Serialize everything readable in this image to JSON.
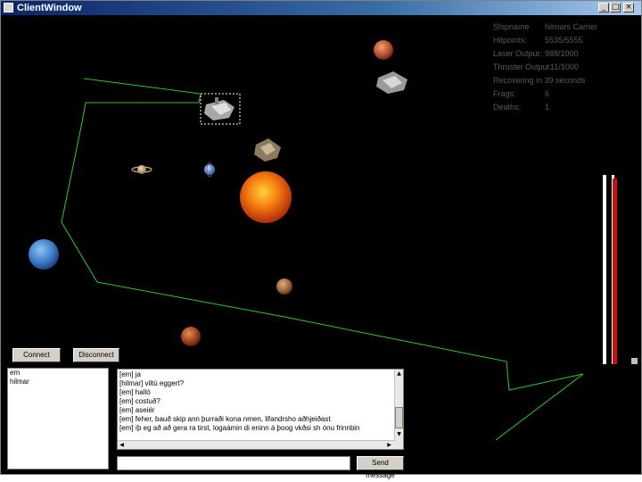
{
  "window": {
    "title": "ClientWindow",
    "minimize": "_",
    "maximize": "□",
    "close": "×"
  },
  "stats": [
    {
      "label": "Shipname",
      "value": "hilmars Carrier"
    },
    {
      "label": "Hitpoints:",
      "value": "5535/5555"
    },
    {
      "label": "Laser Output:",
      "value": "988/1000"
    },
    {
      "label": "Thruster Output:",
      "value": "11/1000"
    },
    {
      "label": "Recovering in 39 seconds",
      "value": ""
    },
    {
      "label": "Frags:",
      "value": "6"
    },
    {
      "label": "Deaths:",
      "value": "1"
    }
  ],
  "buttons": {
    "connect": "Connect",
    "disconnect": "Disconnect",
    "send": "Send message"
  },
  "players": [
    "em",
    "hilmar"
  ],
  "chat": [
    "[em] ja",
    "[hilmar] viltú eggert?",
    "[em] halló",
    "[em] costuð?",
    "[em] aseiér",
    "[em] feher, bauð skip ann þurraði kona nmen, lifandrsho aðhjeiðast",
    "[em] íþ eg að að gera ra tirst, logaámin  di eninn á þoog vkðsi sh ónu frinnbin"
  ],
  "chat_input": {
    "value": ""
  },
  "meters": {
    "laser_level": 0.95,
    "thruster_level": 0.95
  },
  "colors": {
    "territory_line": "#2ec830",
    "meter_red": "#cc1010",
    "meter_white": "#ffffff",
    "stats_text": "#595959"
  }
}
